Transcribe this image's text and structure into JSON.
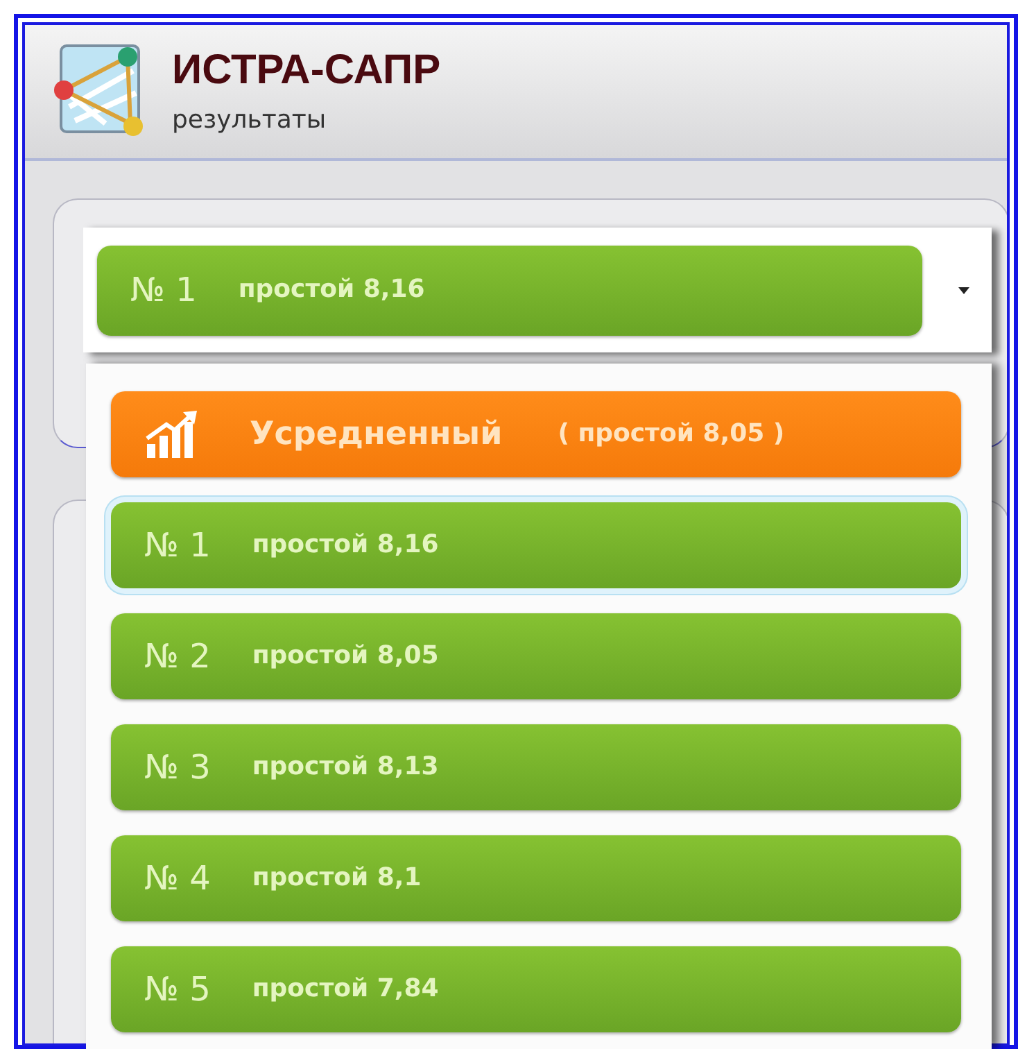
{
  "header": {
    "title": "ИСТРА-САПР",
    "subtitle": "результаты"
  },
  "combo": {
    "number": "№ 1",
    "label": "простой 8,16"
  },
  "dropdown": {
    "items": [
      {
        "kind": "average",
        "number": "Усредненный",
        "label": "( простой 8,05 )",
        "selected": false
      },
      {
        "kind": "result",
        "number": "№ 1",
        "label": "простой 8,16",
        "selected": true
      },
      {
        "kind": "result",
        "number": "№ 2",
        "label": "простой 8,05",
        "selected": false
      },
      {
        "kind": "result",
        "number": "№ 3",
        "label": "простой 8,13",
        "selected": false
      },
      {
        "kind": "result",
        "number": "№ 4",
        "label": "простой 8,1",
        "selected": false
      },
      {
        "kind": "result",
        "number": "№ 5",
        "label": "простой 7,84",
        "selected": false
      }
    ]
  }
}
